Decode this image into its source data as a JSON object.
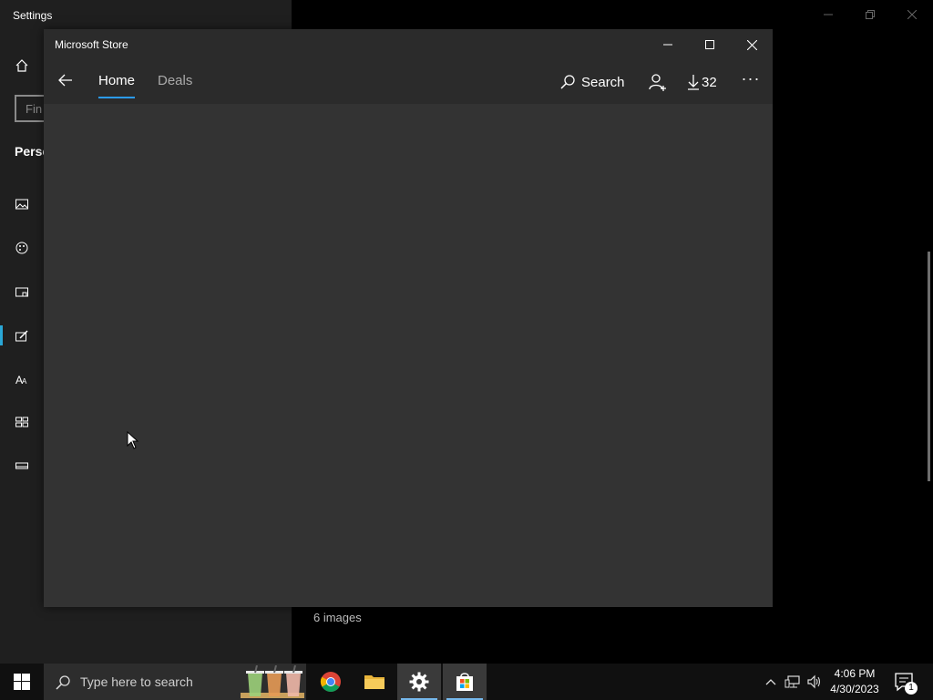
{
  "settings": {
    "title": "Settings",
    "find_placeholder": "Find",
    "section_label": "Personalization",
    "section_visible": "Perso",
    "find_visible": "Fin",
    "images_count": "6 images"
  },
  "store": {
    "title": "Microsoft Store",
    "tabs": [
      {
        "label": "Home",
        "active": true
      },
      {
        "label": "Deals",
        "active": false
      }
    ],
    "search_label": "Search",
    "downloads_count": "32",
    "more_label": "···"
  },
  "taskbar": {
    "search_placeholder": "Type here to search",
    "time": "4:06 PM",
    "date": "4/30/2023",
    "notification_count": "1",
    "apps": [
      {
        "name": "Google Chrome",
        "icon": "chrome-icon"
      },
      {
        "name": "File Explorer",
        "icon": "folder-icon"
      },
      {
        "name": "Settings",
        "icon": "gear-icon"
      },
      {
        "name": "Microsoft Store",
        "icon": "store-icon"
      }
    ]
  },
  "colors": {
    "accent": "#2b9bf0",
    "settings_accent": "#2aa7d6",
    "store_bg": "#2b2b2b",
    "content_bg": "#333333",
    "taskbar_bg": "#101010"
  }
}
